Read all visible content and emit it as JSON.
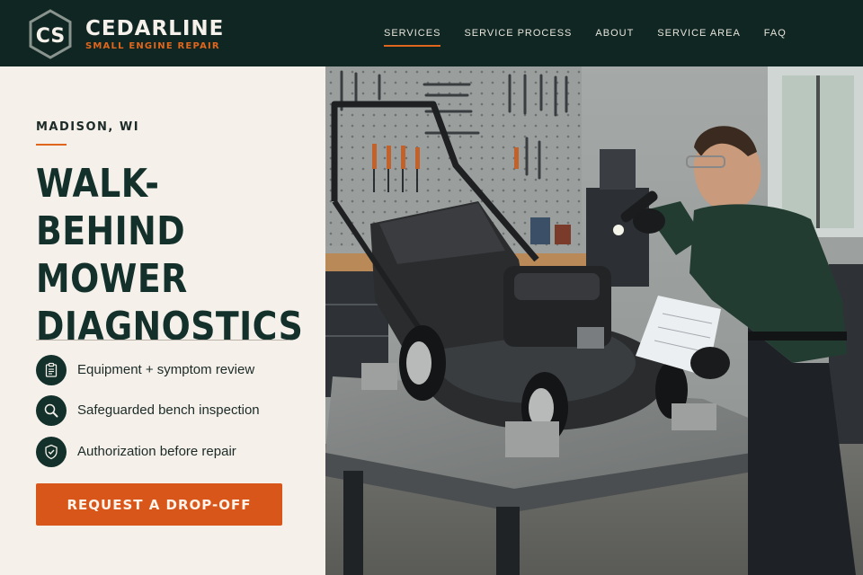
{
  "header": {
    "brand_name": "CEDARLINE",
    "brand_tagline": "SMALL ENGINE REPAIR",
    "logo_text": "CS",
    "nav": [
      {
        "label": "SERVICES",
        "active": true
      },
      {
        "label": "SERVICE PROCESS",
        "active": false
      },
      {
        "label": "ABOUT",
        "active": false
      },
      {
        "label": "SERVICE AREA",
        "active": false
      },
      {
        "label": "FAQ",
        "active": false
      }
    ]
  },
  "hero_panel": {
    "location": "MADISON, WI",
    "headline_lines": [
      "WALK-BEHIND",
      "MOWER",
      "DIAGNOSTICS"
    ],
    "features": [
      {
        "icon": "clipboard-icon",
        "label": "Equipment + symptom review"
      },
      {
        "icon": "magnifier-icon",
        "label": "Safeguarded bench inspection"
      },
      {
        "icon": "shield-check-icon",
        "label": "Authorization before repair"
      }
    ],
    "cta_label": "REQUEST A DROP-OFF"
  },
  "colors": {
    "header_bg": "#0f2622",
    "panel_bg": "#f5f1ea",
    "accent": "#d9561a",
    "headline": "#13302b"
  }
}
